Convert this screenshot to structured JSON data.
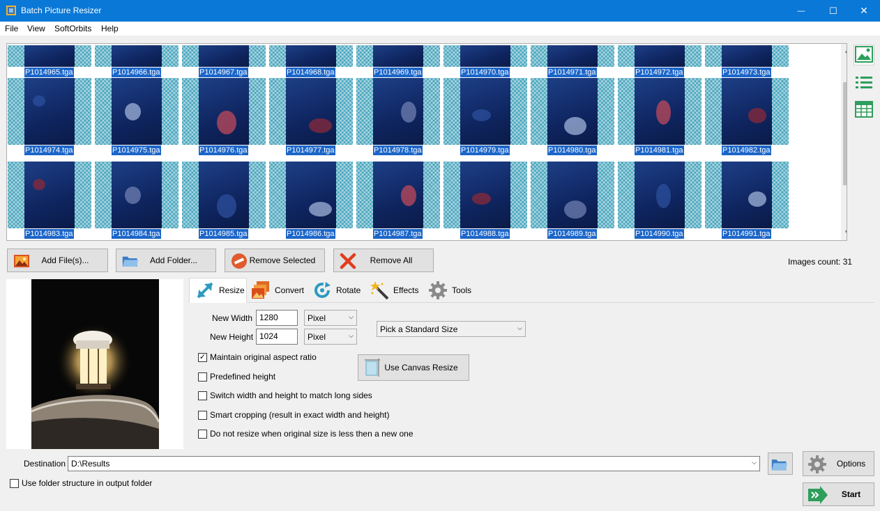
{
  "window": {
    "title": "Batch Picture Resizer",
    "min_glyph": "—",
    "max_glyph": "☐",
    "close_glyph": "✕",
    "accent": "#0a78d7"
  },
  "menu": [
    {
      "label": "File"
    },
    {
      "label": "View"
    },
    {
      "label": "SoftOrbits"
    },
    {
      "label": "Help"
    }
  ],
  "gallery": {
    "selection_color": "#1c66c9",
    "rows": [
      [
        "P1014965.tga",
        "P1014966.tga",
        "P1014967.tga",
        "P1014968.tga",
        "P1014969.tga",
        "P1014970.tga",
        "P1014971.tga",
        "P1014972.tga",
        "P1014973.tga"
      ],
      [
        "P1014974.tga",
        "P1014975.tga",
        "P1014976.tga",
        "P1014977.tga",
        "P1014978.tga",
        "P1014979.tga",
        "P1014980.tga",
        "P1014981.tga",
        "P1014982.tga"
      ],
      [
        "P1014983.tga",
        "P1014984.tga",
        "P1014985.tga",
        "P1014986.tga",
        "P1014987.tga",
        "P1014988.tga",
        "P1014989.tga",
        "P1014990.tga",
        "P1014991.tga"
      ]
    ]
  },
  "view_icons": [
    "thumbnails-view-icon",
    "list-view-icon",
    "table-view-icon"
  ],
  "actions": {
    "add_files": "Add File(s)...",
    "add_folder": "Add Folder...",
    "remove_selected": "Remove Selected",
    "remove_all": "Remove All"
  },
  "images_count": "Images count: 31",
  "tabs": [
    {
      "label": "Resize",
      "icon": "resize-icon"
    },
    {
      "label": "Convert",
      "icon": "convert-icon"
    },
    {
      "label": "Rotate",
      "icon": "rotate-icon"
    },
    {
      "label": "Effects",
      "icon": "effects-wand-icon"
    },
    {
      "label": "Tools",
      "icon": "tools-gear-icon"
    }
  ],
  "resize": {
    "width_label": "New Width",
    "width_value": "1280",
    "width_unit": "Pixel",
    "height_label": "New Height",
    "height_value": "1024",
    "height_unit": "Pixel",
    "standard_size": "Pick a Standard Size",
    "canvas_resize": "Use Canvas Resize",
    "options": [
      {
        "label": "Maintain original aspect ratio",
        "checked": true
      },
      {
        "label": "Predefined height",
        "checked": false
      },
      {
        "label": "Switch width and height to match long sides",
        "checked": false
      },
      {
        "label": "Smart cropping (result in exact width and height)",
        "checked": false
      },
      {
        "label": "Do not resize when original size is less then a new one",
        "checked": false
      }
    ]
  },
  "destination": {
    "label": "Destination",
    "value": "D:\\Results",
    "use_folder_structure": "Use folder structure in output folder",
    "use_folder_structure_checked": false
  },
  "options_button": "Options",
  "start_button": "Start"
}
